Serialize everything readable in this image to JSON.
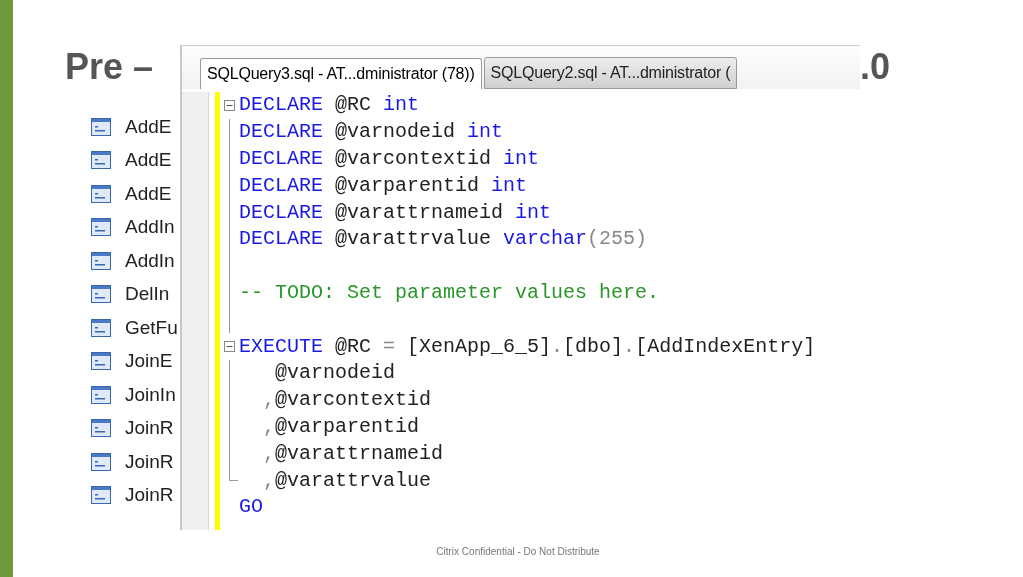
{
  "slide": {
    "title_start": "Pre –",
    "title_end": ".0",
    "footer": "Citrix Confidential - Do Not Distribute"
  },
  "procedures": [
    {
      "name": "AddE"
    },
    {
      "name": "AddE"
    },
    {
      "name": "AddE"
    },
    {
      "name": "AddIn"
    },
    {
      "name": "AddIn"
    },
    {
      "name": "DelIn"
    },
    {
      "name": "GetFu"
    },
    {
      "name": "JoinE"
    },
    {
      "name": "JoinIn"
    },
    {
      "name": "JoinR"
    },
    {
      "name": "JoinR"
    },
    {
      "name": "JoinR"
    }
  ],
  "editor": {
    "tabs": [
      {
        "label": "SQLQuery3.sql - AT...dministrator (78))",
        "selected": true
      },
      {
        "label": "SQLQuery2.sql - AT...dministrator (",
        "selected": false
      }
    ],
    "lines": [
      {
        "kind": "code",
        "fold_start": true,
        "tokens": [
          {
            "kind": "keyword",
            "text": "DECLARE"
          },
          {
            "kind": "plain",
            "text": " @RC "
          },
          {
            "kind": "keyword",
            "text": "int"
          }
        ]
      },
      {
        "kind": "code",
        "tokens": [
          {
            "kind": "keyword",
            "text": "DECLARE"
          },
          {
            "kind": "plain",
            "text": " @varnodeid "
          },
          {
            "kind": "keyword",
            "text": "int"
          }
        ]
      },
      {
        "kind": "code",
        "tokens": [
          {
            "kind": "keyword",
            "text": "DECLARE"
          },
          {
            "kind": "plain",
            "text": " @varcontextid "
          },
          {
            "kind": "keyword",
            "text": "int"
          }
        ]
      },
      {
        "kind": "code",
        "tokens": [
          {
            "kind": "keyword",
            "text": "DECLARE"
          },
          {
            "kind": "plain",
            "text": " @varparentid "
          },
          {
            "kind": "keyword",
            "text": "int"
          }
        ]
      },
      {
        "kind": "code",
        "tokens": [
          {
            "kind": "keyword",
            "text": "DECLARE"
          },
          {
            "kind": "plain",
            "text": " @varattrnameid "
          },
          {
            "kind": "keyword",
            "text": "int"
          }
        ]
      },
      {
        "kind": "code",
        "tokens": [
          {
            "kind": "keyword",
            "text": "DECLARE"
          },
          {
            "kind": "plain",
            "text": " @varattrvalue "
          },
          {
            "kind": "keyword",
            "text": "varchar"
          },
          {
            "kind": "operator",
            "text": "(255)"
          }
        ]
      },
      {
        "kind": "blank"
      },
      {
        "kind": "code",
        "tokens": [
          {
            "kind": "comment",
            "text": "-- TODO: Set parameter values here."
          }
        ]
      },
      {
        "kind": "blank"
      },
      {
        "kind": "code",
        "fold_start": true,
        "tokens": [
          {
            "kind": "keyword",
            "text": "EXECUTE"
          },
          {
            "kind": "plain",
            "text": " @RC "
          },
          {
            "kind": "operator",
            "text": "="
          },
          {
            "kind": "plain",
            "text": " [XenApp_6_5]"
          },
          {
            "kind": "operator",
            "text": "."
          },
          {
            "kind": "plain",
            "text": "[dbo]"
          },
          {
            "kind": "operator",
            "text": "."
          },
          {
            "kind": "plain",
            "text": "[AddIndexEntry]"
          }
        ]
      },
      {
        "kind": "code",
        "tokens": [
          {
            "kind": "plain",
            "text": "   @varnodeid"
          }
        ]
      },
      {
        "kind": "code",
        "tokens": [
          {
            "kind": "operator",
            "text": "  ,"
          },
          {
            "kind": "plain",
            "text": "@varcontextid"
          }
        ]
      },
      {
        "kind": "code",
        "tokens": [
          {
            "kind": "operator",
            "text": "  ,"
          },
          {
            "kind": "plain",
            "text": "@varparentid"
          }
        ]
      },
      {
        "kind": "code",
        "tokens": [
          {
            "kind": "operator",
            "text": "  ,"
          },
          {
            "kind": "plain",
            "text": "@varattrnameid"
          }
        ]
      },
      {
        "kind": "code",
        "fold_end": true,
        "tokens": [
          {
            "kind": "operator",
            "text": "  ,"
          },
          {
            "kind": "plain",
            "text": "@varattrvalue"
          }
        ]
      },
      {
        "kind": "code",
        "tokens": [
          {
            "kind": "keyword",
            "text": "GO"
          }
        ]
      }
    ]
  }
}
